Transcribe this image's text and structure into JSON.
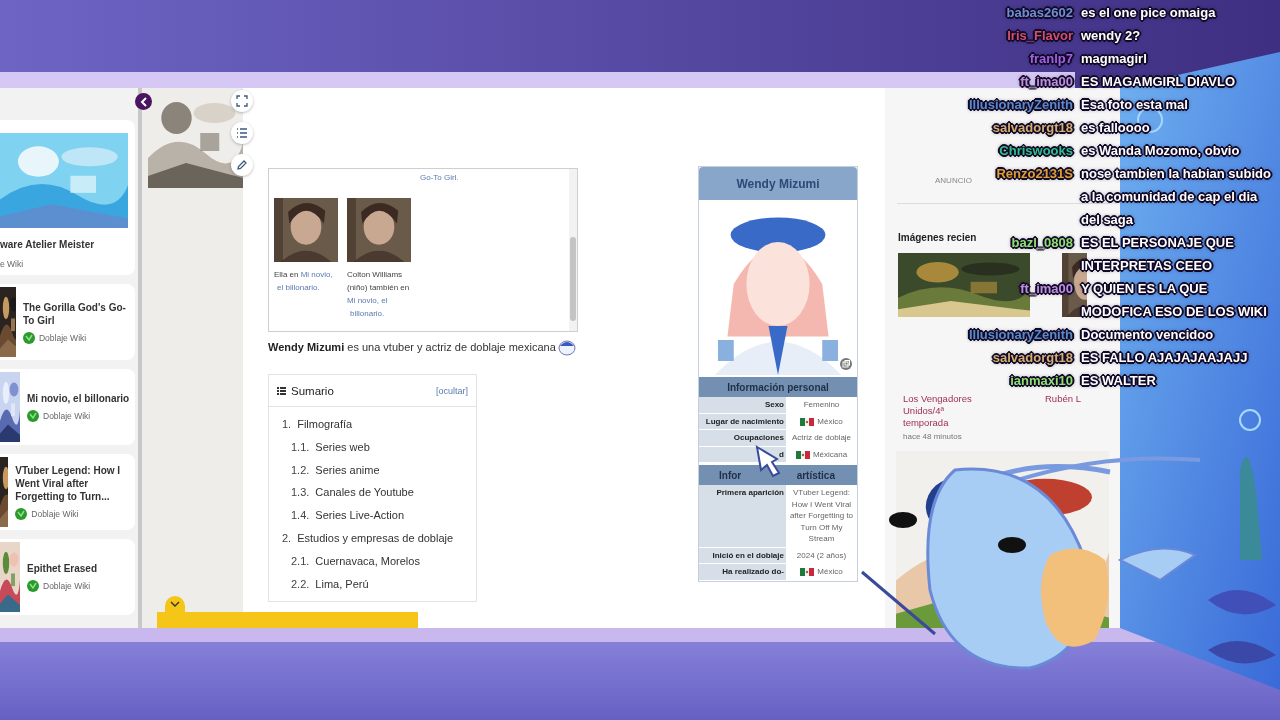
{
  "sidebar": {
    "cards": [
      {
        "kind": "featured",
        "title": "ware Atelier Meister",
        "source": "e Wiki"
      },
      {
        "kind": "compact",
        "title": "The Gorilla God's Go-To Girl",
        "source": "Doblaje Wiki"
      },
      {
        "kind": "compact",
        "title": "Mi novio, el billonario",
        "source": "Doblaje Wiki"
      },
      {
        "kind": "compact",
        "title": "VTuber Legend: How I Went Viral after Forgetting to Turn...",
        "source": "Doblaje Wiki"
      },
      {
        "kind": "compact",
        "title": "Epithet Erased",
        "source": "Doblaje Wiki"
      }
    ]
  },
  "gallery": {
    "partial_caption": {
      "text": "Go-To Girl.",
      "link": true
    },
    "items": [
      {
        "caption": [
          {
            "text": "Ella en ",
            "link": false
          },
          {
            "text": "Mi novio,",
            "link": true
          },
          {
            "text": "el billonario.",
            "link": true
          }
        ]
      },
      {
        "caption": [
          {
            "text": "Colton Williams (niño) también en ",
            "link": false
          },
          {
            "text": "Mi novio, el",
            "link": true
          },
          {
            "text": "billonario.",
            "link": true
          }
        ]
      }
    ]
  },
  "intro": "**Wendy Mizumi** es una vtuber y actriz de doblaje mexicana",
  "toc": {
    "title": "Sumario",
    "toggle": "[ocultar]",
    "items": [
      {
        "number": "1.",
        "label": "Filmografía",
        "children": [
          {
            "number": "1.1.",
            "label": "Series web"
          },
          {
            "number": "1.2.",
            "label": "Series anime"
          },
          {
            "number": "1.3.",
            "label": "Canales de Youtube"
          },
          {
            "number": "1.4.",
            "label": "Series Live-Action"
          }
        ]
      },
      {
        "number": "2.",
        "label": "Estudios y empresas de doblaje",
        "children": [
          {
            "number": "2.1.",
            "label": "Cuernavaca, Morelos"
          },
          {
            "number": "2.2.",
            "label": "Lima, Perú"
          }
        ]
      }
    ]
  },
  "infobox": {
    "title": "Wendy Mizumi",
    "sections": [
      {
        "title_parts": [
          "Información personal"
        ],
        "rows": [
          {
            "label": "Sexo",
            "value": "Femenino",
            "flag": false
          },
          {
            "label": "Lugar de nacimiento",
            "value": "México",
            "flag": true
          },
          {
            "label": "Ocupaciones",
            "value": "Actriz de doblaje",
            "flag": false
          },
          {
            "label": "d",
            "value": "Méxicana",
            "flag": true
          }
        ]
      },
      {
        "title_parts": [
          "Infor",
          "artística"
        ],
        "rows": [
          {
            "label": "Primera aparición",
            "value": "VTuber Legend: How I Went Viral after Forgetting to Turn Off My Stream",
            "flag": false
          },
          {
            "label": "Inició en el doblaje",
            "value": "2024 (2 años)",
            "flag": false
          },
          {
            "label": "Ha realizado do-",
            "value": "México",
            "flag": true
          }
        ]
      }
    ]
  },
  "recent": {
    "ad_label": "ANUNCIO",
    "heading": "Imágenes recien",
    "items": [
      {
        "title": "Los Vengadores Unidos/4ª temporada",
        "time": "hace 48 minutos"
      },
      {
        "title": "Rubén L"
      }
    ]
  },
  "chat": [
    {
      "user": "babas2602",
      "color": "#6f8fd0",
      "text": "es el one pice omaiga"
    },
    {
      "user": "Iris_Flavor",
      "color": "#d0506a",
      "text": "wendy 2?"
    },
    {
      "user": "franlp7",
      "color": "#a060e0",
      "text": "magmagirl"
    },
    {
      "user": "ft_ima00",
      "color": "#c090e0",
      "text": "ES MAGAMGIRL DIAVLO"
    },
    {
      "user": "IllusionaryZenith",
      "color": "#5a8ac8",
      "text": "Esa foto esta mal"
    },
    {
      "user": "salvadorgt18",
      "color": "#d4b070",
      "text": "es falloooo"
    },
    {
      "user": "Chriswooks",
      "color": "#2ec08a",
      "text": "es Wanda Mozomo, obvio"
    },
    {
      "user": "Renzo2131S",
      "color": "#e0a030",
      "text": "nose tambien la habian subido a la comunidad de cap el dia del saga"
    },
    {
      "user": "bazl_0808",
      "color": "#90e070",
      "text": "ES EL PERSONAJE QUE INTERPRETAS CEEO"
    },
    {
      "user": "ft_ima00",
      "color": "#c090e0",
      "text": "Y QUIEN ES LA QUE MODOFICA ESO DE LOS WIKI"
    },
    {
      "user": "IllusionaryZenith",
      "color": "#5a8ac8",
      "text": "Documento vencidoo"
    },
    {
      "user": "salvadorgt18",
      "color": "#d4b070",
      "text": "ES FALLO AJAJAJAAJAJJ"
    },
    {
      "user": "ianmaxi10",
      "color": "#90e070",
      "text": "ES WALTER"
    }
  ]
}
